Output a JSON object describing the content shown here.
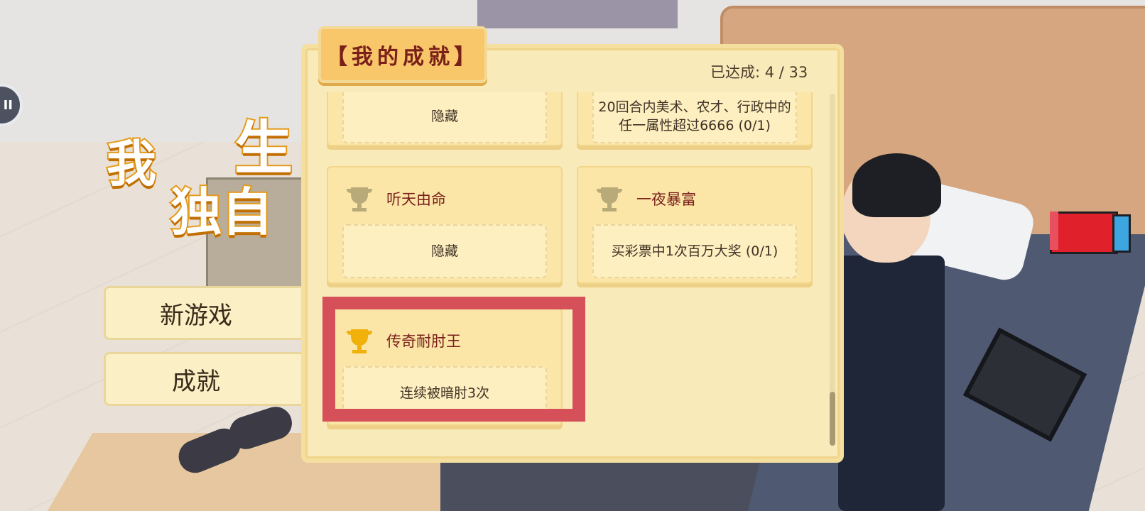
{
  "background": {
    "logo_chars": [
      "我",
      "独自",
      "生"
    ]
  },
  "pause_icon": "II",
  "menu": {
    "new_game_label": "新游戏",
    "achievements_label": "成就"
  },
  "panel": {
    "title": "【我的成就】",
    "progress_label": "已达成:",
    "progress_value": "4 / 33",
    "scroll_position": 0.92
  },
  "achievements": [
    {
      "title": "",
      "description": "隐藏",
      "unlocked": false
    },
    {
      "title": "",
      "description": "20回合内美术、农才、行政中的任一属性超过6666 (0/1)",
      "unlocked": false
    },
    {
      "title": "听天由命",
      "description": "隐藏",
      "unlocked": false
    },
    {
      "title": "一夜暴富",
      "description": "买彩票中1次百万大奖 (0/1)",
      "unlocked": false
    },
    {
      "title": "传奇耐肘王",
      "description": "连续被暗肘3次",
      "unlocked": true
    }
  ],
  "colors": {
    "trophy_locked": "#b9aa7a",
    "trophy_unlocked": "#f2b10a",
    "highlight": "#d6505a",
    "title_red": "#7a1f1a"
  }
}
